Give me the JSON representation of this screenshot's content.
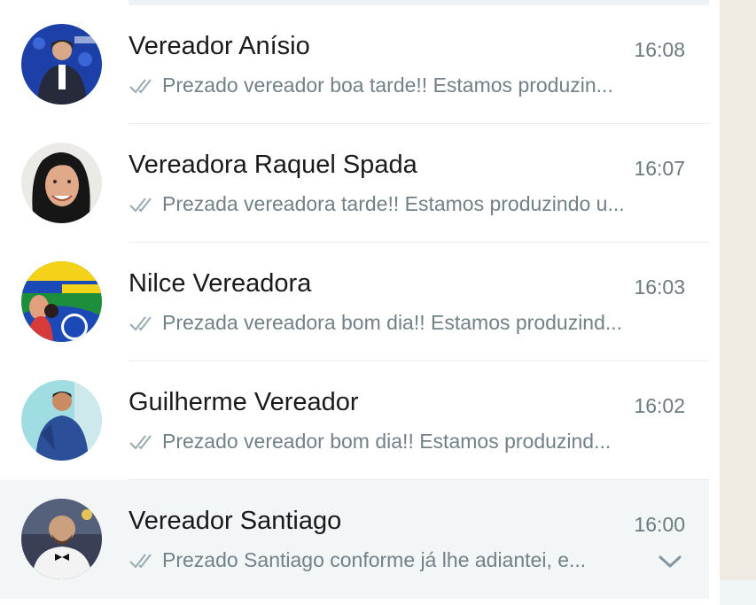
{
  "chats": [
    {
      "name": "Vereador Anísio",
      "time": "16:08",
      "preview": "Prezado vereador boa tarde!! Estamos produzin...",
      "avatar_icon": "person-photo-blue-banner"
    },
    {
      "name": "Vereadora Raquel Spada",
      "time": "16:07",
      "preview": "Prezada vereadora tarde!! Estamos produzindo u...",
      "avatar_icon": "person-photo-woman"
    },
    {
      "name": "Nilce Vereadora",
      "time": "16:03",
      "preview": "Prezada vereadora bom dia!! Estamos produzind...",
      "avatar_icon": "campaign-flyer-55200"
    },
    {
      "name": "Guilherme Vereador",
      "time": "16:02",
      "preview": "Prezado vereador bom dia!! Estamos produzind...",
      "avatar_icon": "person-photo-man-teal"
    },
    {
      "name": "Vereador Santiago",
      "time": "16:00",
      "preview": "Prezado Santiago conforme já lhe adiantei, e...",
      "avatar_icon": "person-photo-man-bowtie"
    }
  ],
  "colors": {
    "tick": "#9aaab1",
    "hover_row": "#f3f6f6",
    "wallpaper": "#efeae2"
  }
}
